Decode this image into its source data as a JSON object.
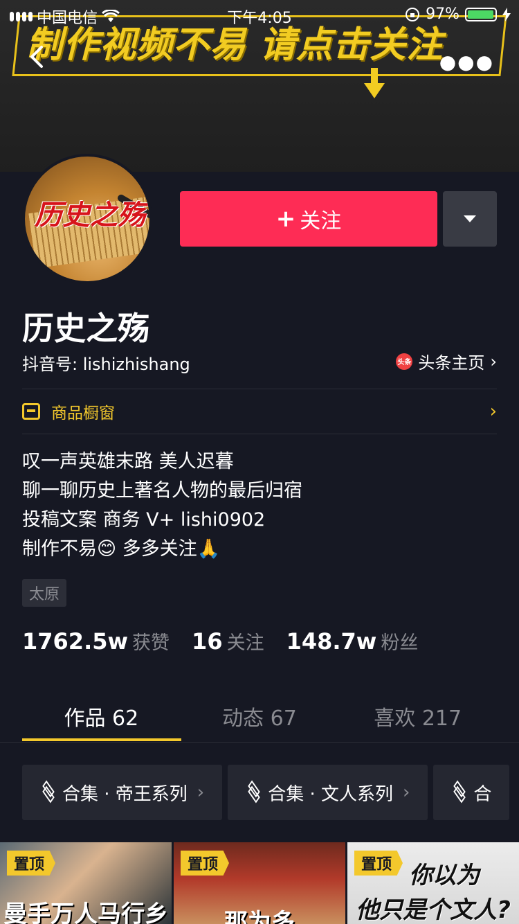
{
  "status_bar": {
    "carrier": "中国电信",
    "time": "下午4:05",
    "battery_text": "97%"
  },
  "banner": {
    "text": "制作视频不易  请点击关注"
  },
  "nav": {
    "more_icon": "more-dots-icon"
  },
  "profile": {
    "avatar_text": "历史之殇",
    "name": "历史之殇",
    "douyin_id": "抖音号: lishizhishang",
    "toutiao_badge": "头条",
    "toutiao_link": "头条主页"
  },
  "actions": {
    "follow_plus": "+",
    "follow_label": "关注"
  },
  "shop": {
    "label": "商品橱窗"
  },
  "bio": {
    "line1": "叹一声英雄末路 美人迟暮",
    "line2": "聊一聊历史上著名人物的最后归宿",
    "line3": "投稿文案 商务 V+ lishi0902",
    "line4": "制作不易😊 多多关注🙏"
  },
  "tag": "太原",
  "stats": {
    "likes_num": "1762.5w",
    "likes_label": "获赞",
    "following_num": "16",
    "following_label": "关注",
    "fans_num": "148.7w",
    "fans_label": "粉丝"
  },
  "tabs": {
    "works": "作品 62",
    "dynamics": "动态 67",
    "likes": "喜欢 217"
  },
  "collections": [
    {
      "label": "合集 · 帝王系列"
    },
    {
      "label": "合集 · 文人系列"
    },
    {
      "label": "合"
    }
  ],
  "videos": [
    {
      "badge": "置顶",
      "caption": "曼手万人马行乡"
    },
    {
      "badge": "置顶",
      "caption": "那为多"
    },
    {
      "badge": "置顶",
      "caption_line1": "你以为",
      "caption_line2": "他只是个文人?"
    }
  ],
  "colors": {
    "background": "#161823",
    "follow_button": "#fe2c55",
    "accent_yellow": "#f3c82c",
    "muted_text": "#8a8b91"
  }
}
